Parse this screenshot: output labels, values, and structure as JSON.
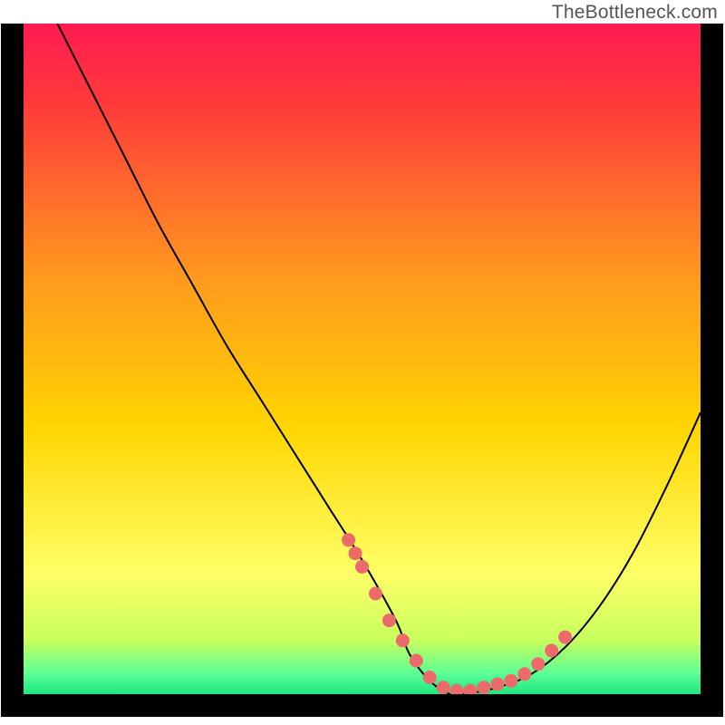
{
  "watermark": "TheBottleneck.com",
  "chart_data": {
    "type": "line",
    "title": "",
    "xlabel": "",
    "ylabel": "",
    "xlim": [
      0,
      100
    ],
    "ylim": [
      0,
      100
    ],
    "series": [
      {
        "name": "bottleneck-curve",
        "x": [
          5,
          10,
          15,
          20,
          25,
          30,
          35,
          40,
          45,
          50,
          55,
          57,
          60,
          63,
          65,
          70,
          75,
          80,
          85,
          90,
          95,
          100
        ],
        "y": [
          100,
          90,
          80,
          70,
          61,
          52,
          44,
          36,
          28,
          20,
          11,
          6,
          2,
          0,
          0,
          1,
          3,
          7,
          13,
          21,
          31,
          42
        ]
      }
    ],
    "markers": {
      "name": "sample-points",
      "x": [
        48,
        49,
        50,
        52,
        54,
        56,
        58,
        60,
        62,
        64,
        66,
        68,
        70,
        72,
        74,
        76,
        78,
        80
      ],
      "y": [
        23,
        21,
        19,
        15,
        11,
        8,
        5,
        2.5,
        1,
        0.5,
        0.5,
        1,
        1.5,
        2,
        3,
        4.5,
        6.5,
        8.5
      ]
    },
    "background_gradient": {
      "top_color": "#ff1b52",
      "mid_color": "#ffd500",
      "low_color": "#ffff66",
      "bottom_color": "#1ee57f"
    }
  }
}
